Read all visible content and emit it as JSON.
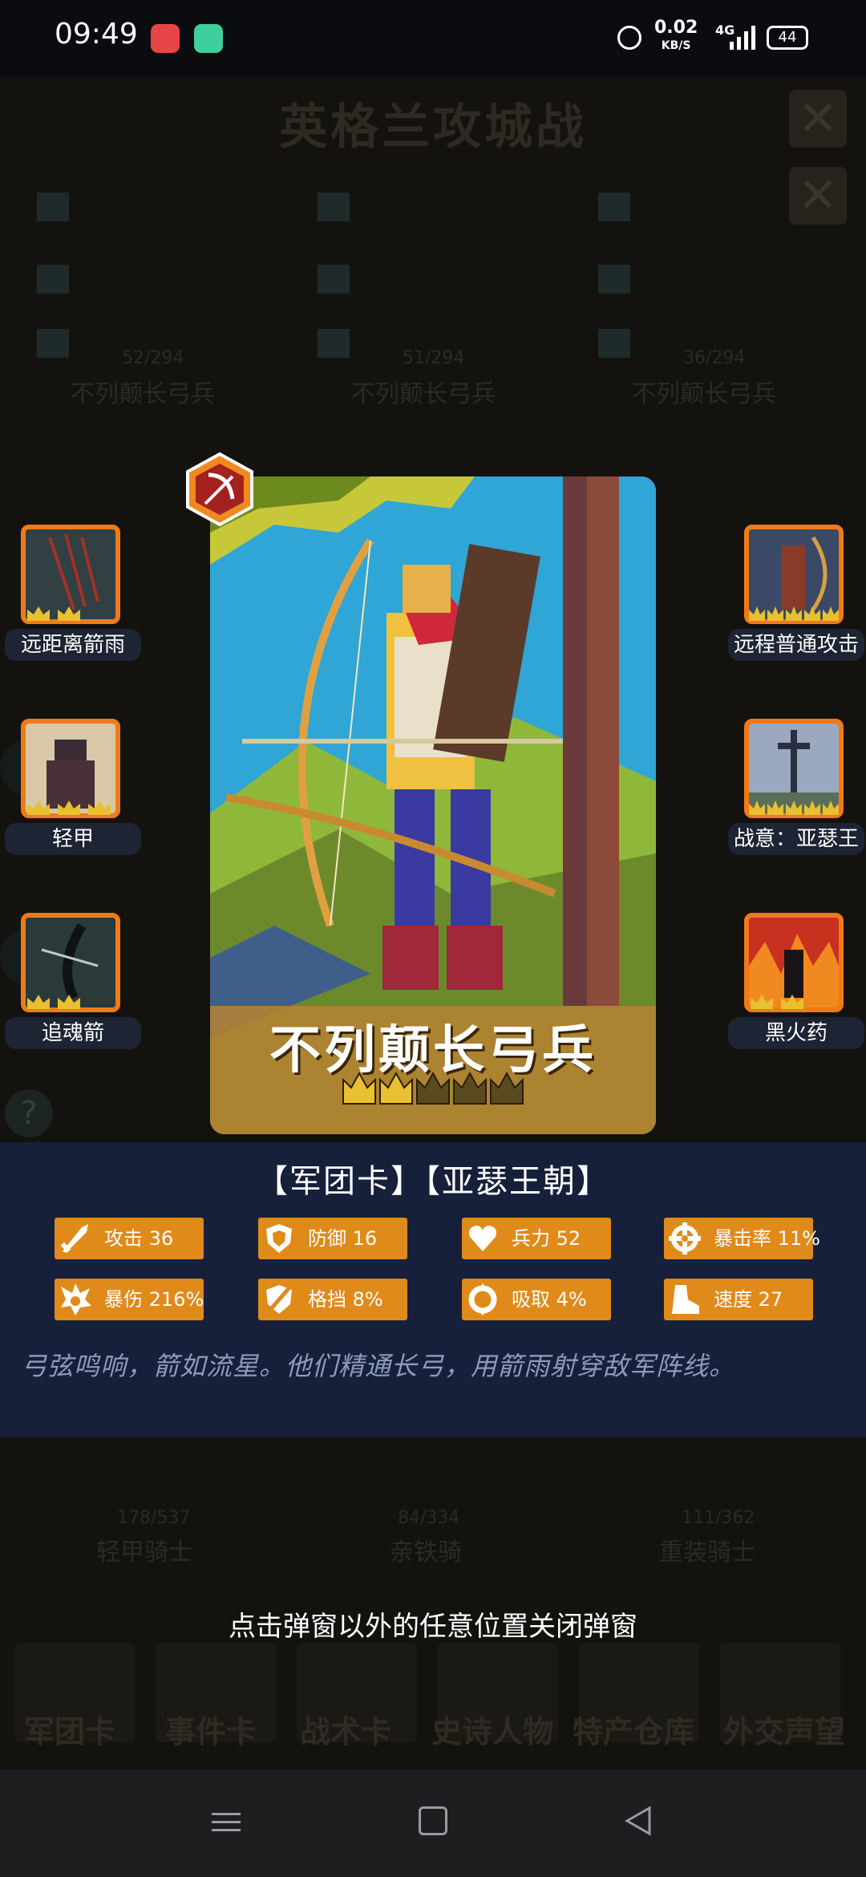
{
  "status_bar": {
    "time": "09:49",
    "net_speed": "0.02",
    "net_unit": "KB/S",
    "network_type": "4G",
    "battery": "44"
  },
  "background": {
    "title": "英格兰攻城战",
    "close_icon": "close-icon",
    "top_units": [
      {
        "count": "52/294",
        "name": "不列颠长弓兵"
      },
      {
        "count": "51/294",
        "name": "不列颠长弓兵"
      },
      {
        "count": "36/294",
        "name": "不列颠长弓兵"
      }
    ],
    "mid_units": [
      {
        "count": "178/537",
        "name": "轻甲骑士"
      },
      {
        "count": "84/334",
        "name": "亲铁骑"
      },
      {
        "count": "111/362",
        "name": "重装骑士"
      }
    ],
    "bottom_nav": [
      "军团卡",
      "事件卡",
      "战术卡",
      "史诗人物",
      "特产仓库",
      "外交声望"
    ],
    "help_label": "?"
  },
  "skills_left": [
    {
      "label": "远距离箭雨",
      "icon": "arrow-rain-icon"
    },
    {
      "label": "轻甲",
      "icon": "light-armor-icon"
    },
    {
      "label": "追魂箭",
      "icon": "soul-arrow-icon"
    }
  ],
  "skills_right": [
    {
      "label": "远程普通攻击",
      "icon": "ranged-attack-icon"
    },
    {
      "label": "战意：亚瑟王",
      "icon": "sword-icon"
    },
    {
      "label": "黑火药",
      "icon": "black-powder-icon"
    }
  ],
  "card": {
    "name": "不列颠长弓兵",
    "badge_icon": "bow-badge-icon",
    "stars_filled": 2,
    "stars_total": 5
  },
  "panel": {
    "title": "【军团卡】【亚瑟王朝】",
    "stats": [
      {
        "label": "攻击",
        "value": "36",
        "icon": "sword-stat-icon"
      },
      {
        "label": "防御",
        "value": "16",
        "icon": "shield-stat-icon"
      },
      {
        "label": "兵力",
        "value": "52",
        "icon": "heart-stat-icon"
      },
      {
        "label": "暴击率",
        "value": "11%",
        "icon": "crit-rate-icon"
      },
      {
        "label": "暴伤",
        "value": "216%",
        "icon": "crit-damage-icon"
      },
      {
        "label": "格挡",
        "value": "8%",
        "icon": "block-icon"
      },
      {
        "label": "吸取",
        "value": "4%",
        "icon": "lifesteal-icon"
      },
      {
        "label": "速度",
        "value": "27",
        "icon": "boot-icon"
      }
    ],
    "description": "弓弦鸣响，箭如流星。他们精通长弓，用箭雨射穿敌军阵线。"
  },
  "hint": "点击弹窗以外的任意位置关闭弹窗",
  "colors": {
    "accent_orange": "#e08a1a",
    "panel_bg": "#16203a",
    "star_gold": "#e8c030"
  }
}
